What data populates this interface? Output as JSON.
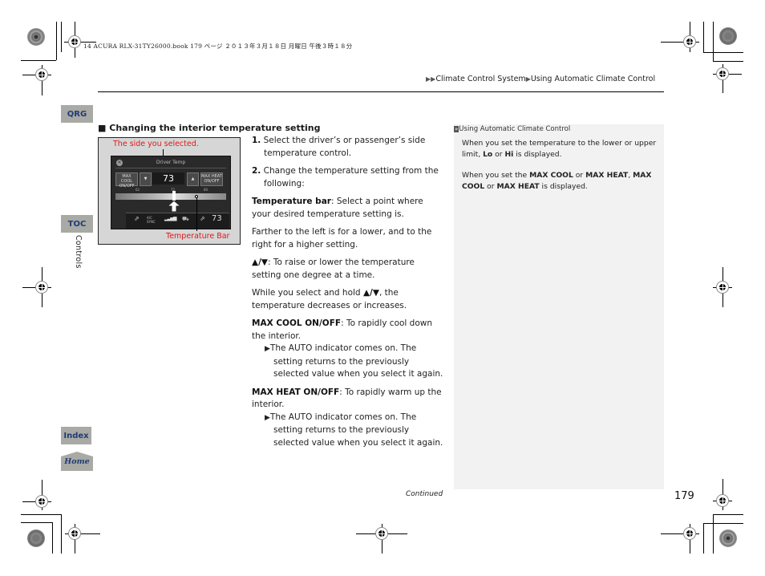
{
  "print_header": "14 ACURA RLX-31TY26000.book  179 ページ  ２０１３年３月１８日  月曜日  午後３時１８分",
  "breadcrumb": {
    "arrow_icon": "▶▶",
    "items": [
      "Climate Control System",
      "Using Automatic Climate Control"
    ],
    "separator": "▶"
  },
  "nav": {
    "qrg": "QRG",
    "toc": "TOC",
    "section_label": "Controls",
    "index": "Index",
    "home": "Home"
  },
  "section": {
    "title": "Changing the interior temperature setting",
    "bullet": "■"
  },
  "figure": {
    "callout_top": "The side you selected.",
    "callout_bottom": "Temperature Bar",
    "screen": {
      "title": "Driver Temp",
      "max_cool": "MAX COOL ON/OFF",
      "max_heat": "MAX HEAT ON/OFF",
      "temp": "73",
      "down_arrow": "▼",
      "up_arrow": "▲",
      "ac_sync": "A/C SYNC",
      "passenger_temp": "73",
      "scale_labels": [
        "62",
        "72",
        "80"
      ]
    }
  },
  "steps": [
    {
      "num": "1.",
      "text": "Select the driver’s or passenger’s side temperature control."
    },
    {
      "num": "2.",
      "text": "Change the temperature setting from the following:"
    }
  ],
  "paragraphs": {
    "temp_bar_label": "Temperature bar",
    "temp_bar_text": ": Select a point where your desired temperature setting is.",
    "farther": "Farther to the left is for a lower, and to the right for a higher setting.",
    "arrows_label": "▲/▼",
    "arrows_text": ": To raise or lower the temperature setting one degree at a time.",
    "hold_pre": "While you select and hold ",
    "hold_arrows": "▲/▼",
    "hold_post": ", the temperature decreases or increases.",
    "max_cool_label": "MAX COOL ON/OFF",
    "max_cool_text": ": To rapidly cool down the interior.",
    "max_cool_note": "The AUTO indicator comes on. The setting returns to the previously selected value when you select it again.",
    "max_heat_label": "MAX HEAT ON/OFF",
    "max_heat_text": ": To rapidly warm up the interior.",
    "max_heat_note": "The AUTO indicator comes on. The setting returns to the previously selected value when you select it again.",
    "note_arrow": "▶"
  },
  "sidebar_note": {
    "icon": "»",
    "heading": "Using Automatic Climate Control",
    "p1_pre": "When you set the temperature to the lower or upper limit, ",
    "p1_lo": "Lo",
    "p1_or": " or ",
    "p1_hi": "Hi",
    "p1_post": " is displayed.",
    "p2_pre": "When you set the ",
    "p2_b1": "MAX COOL",
    "p2_or1": " or ",
    "p2_b2": "MAX HEAT",
    "p2_comma": ", ",
    "p2_b3": "MAX COOL",
    "p2_or2": " or ",
    "p2_b4": "MAX HEAT",
    "p2_post": " is displayed."
  },
  "footer": {
    "continued": "Continued",
    "page_number": "179"
  }
}
